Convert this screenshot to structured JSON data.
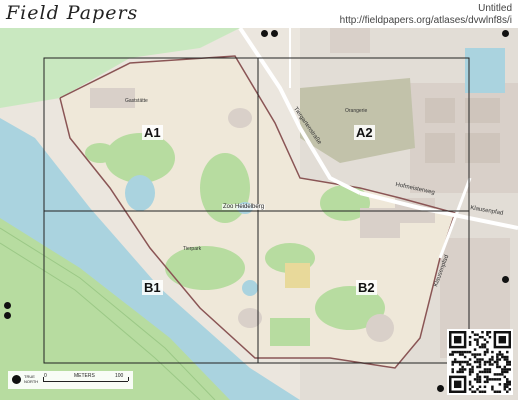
{
  "header": {
    "logo": "Field Papers",
    "title": "Untitled",
    "url": "http://fieldpapers.org/atlases/dvwlnf8s/i"
  },
  "map": {
    "grid_labels": [
      "A1",
      "A2",
      "B1",
      "B2"
    ],
    "place_label": "Zoo Heidelberg",
    "street_labels": [
      "Tiergartenstraße",
      "Hofmeisterweg",
      "Klausenpfad",
      "Klausenpfad"
    ],
    "poi_labels": [
      "Gaststätte",
      "Tierpark",
      "Orangerie"
    ],
    "colors": {
      "river": "#aad3df",
      "park": "#c8e5b0",
      "zoo": "#efe8d9",
      "building": "#d9d0c9",
      "boundary": "#8a5555",
      "grid": "#222222",
      "field": "#b7dca0"
    }
  },
  "scale": {
    "north_text": [
      "TRUE",
      "NORTH"
    ],
    "start": "0",
    "unit": "METERS",
    "end": "100"
  },
  "qr_code": {
    "icon": "qr-code-icon"
  }
}
